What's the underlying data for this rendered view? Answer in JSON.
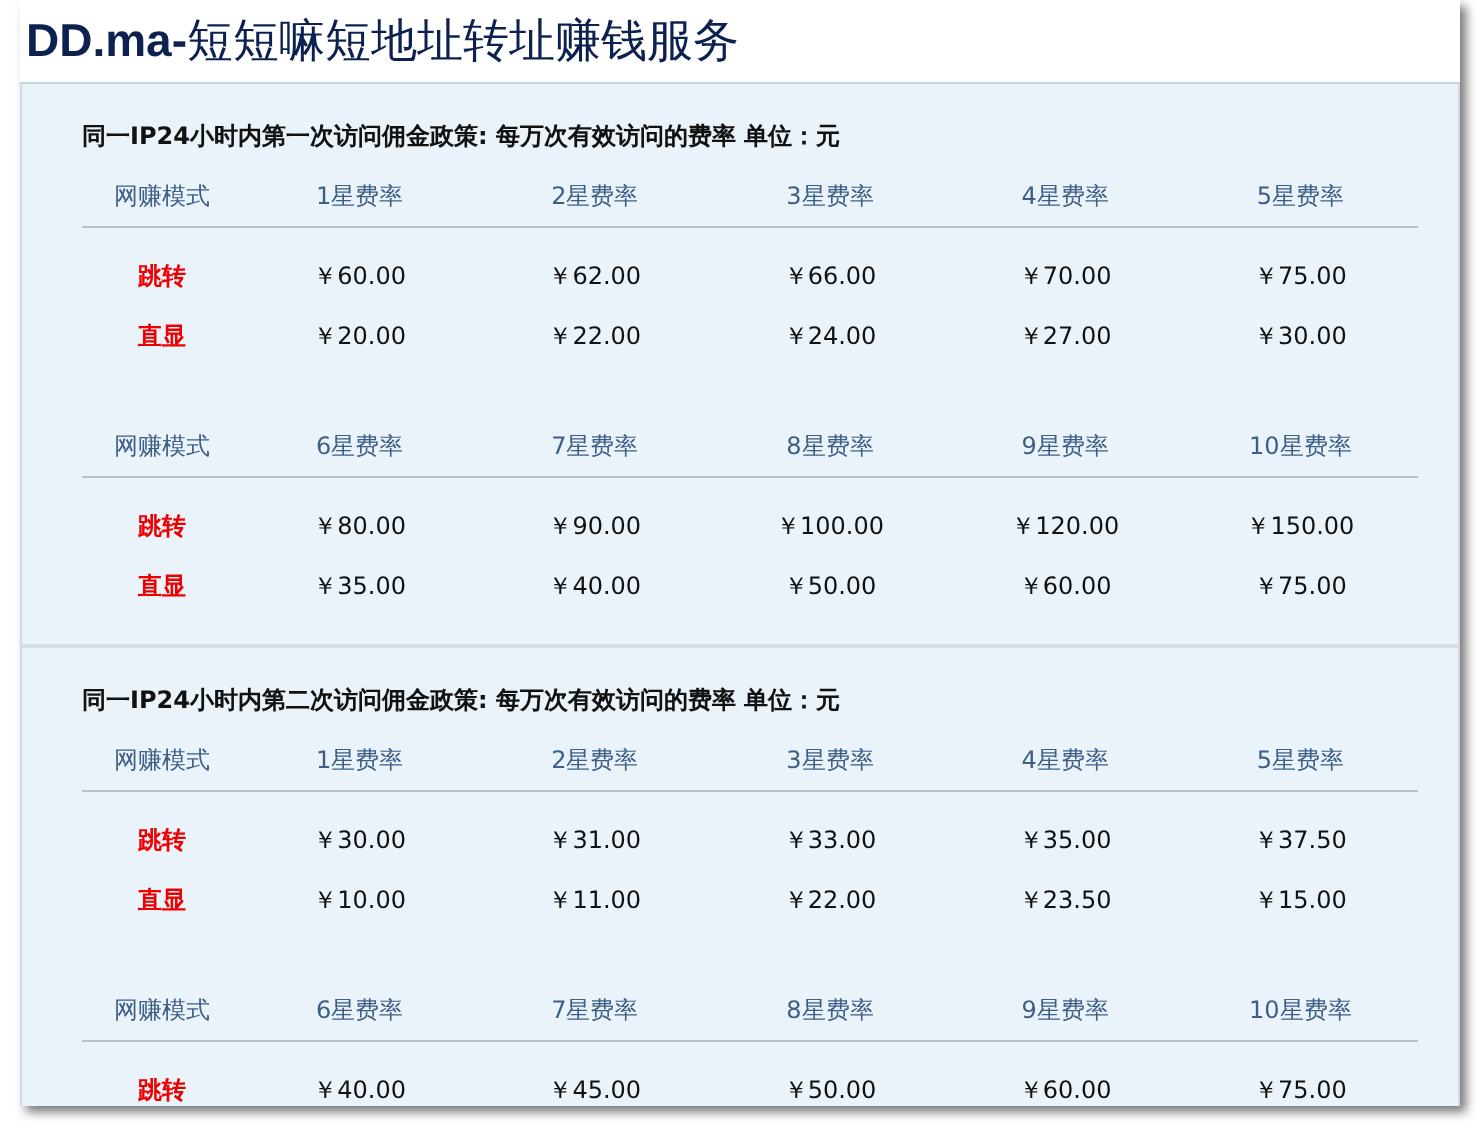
{
  "title": "**DD.ma-**短短嘛短地址转址赚钱服务",
  "sections": [
    {
      "heading": "同一IP24小时内第一次访问佣金政策: 每万次有效访问的费率 单位：元",
      "tables": [
        {
          "columns": [
            "网赚模式",
            "1星费率",
            "2星费率",
            "3星费率",
            "4星费率",
            "5星费率"
          ],
          "rows": [
            {
              "mode": "跳转",
              "values": [
                "￥60.00",
                "￥62.00",
                "￥66.00",
                "￥70.00",
                "￥75.00"
              ]
            },
            {
              "mode": "直显",
              "values": [
                "￥20.00",
                "￥22.00",
                "￥24.00",
                "￥27.00",
                "￥30.00"
              ]
            }
          ]
        },
        {
          "columns": [
            "网赚模式",
            "6星费率",
            "7星费率",
            "8星费率",
            "9星费率",
            "10星费率"
          ],
          "rows": [
            {
              "mode": "跳转",
              "values": [
                "￥80.00",
                "￥90.00",
                "￥100.00",
                "￥120.00",
                "￥150.00"
              ]
            },
            {
              "mode": "直显",
              "values": [
                "￥35.00",
                "￥40.00",
                "￥50.00",
                "￥60.00",
                "￥75.00"
              ]
            }
          ]
        }
      ]
    },
    {
      "heading": "同一IP24小时内第二次访问佣金政策: 每万次有效访问的费率 单位：元",
      "tables": [
        {
          "columns": [
            "网赚模式",
            "1星费率",
            "2星费率",
            "3星费率",
            "4星费率",
            "5星费率"
          ],
          "rows": [
            {
              "mode": "跳转",
              "values": [
                "￥30.00",
                "￥31.00",
                "￥33.00",
                "￥35.00",
                "￥37.50"
              ]
            },
            {
              "mode": "直显",
              "values": [
                "￥10.00",
                "￥11.00",
                "￥22.00",
                "￥23.50",
                "￥15.00"
              ]
            }
          ]
        },
        {
          "columns": [
            "网赚模式",
            "6星费率",
            "7星费率",
            "8星费率",
            "9星费率",
            "10星费率"
          ],
          "rows": [
            {
              "mode": "跳转",
              "values": [
                "￥40.00",
                "￥45.00",
                "￥50.00",
                "￥60.00",
                "￥75.00"
              ]
            }
          ]
        }
      ]
    }
  ]
}
